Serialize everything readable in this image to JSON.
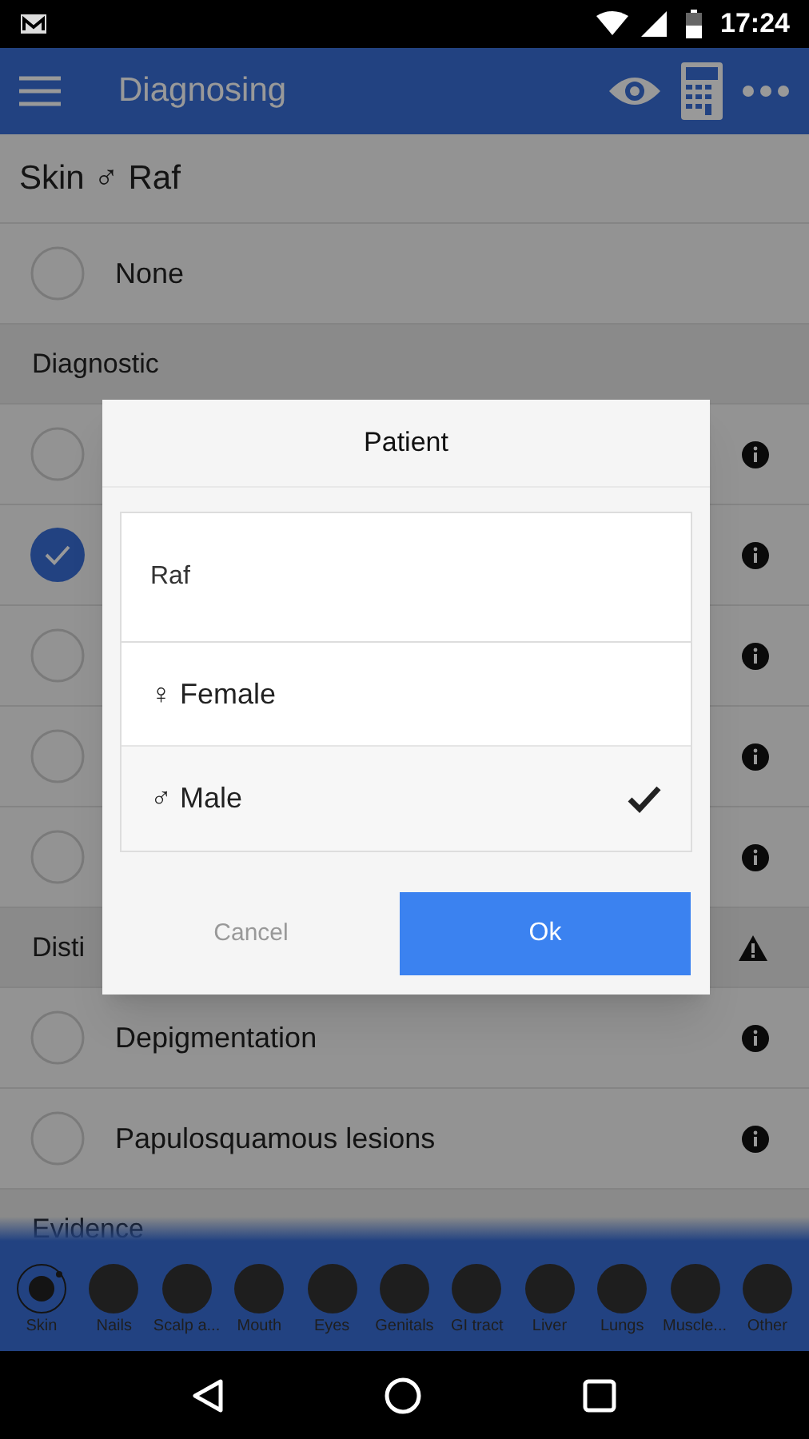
{
  "status_bar": {
    "time": "17:24"
  },
  "toolbar": {
    "title": "Diagnosing"
  },
  "subtitle": "Skin ♂ Raf",
  "list": [
    {
      "kind": "row",
      "label": "None",
      "checked": false,
      "info": false
    },
    {
      "kind": "section",
      "label": "Diagnostic"
    },
    {
      "kind": "row",
      "checked": false,
      "info": true
    },
    {
      "kind": "row",
      "checked": true,
      "info": true
    },
    {
      "kind": "row",
      "checked": false,
      "info": true
    },
    {
      "kind": "row",
      "checked": false,
      "info": true
    },
    {
      "kind": "row",
      "checked": false,
      "info": true
    },
    {
      "kind": "section",
      "label": "Disti",
      "warning": true
    },
    {
      "kind": "row",
      "label": "Depigmentation",
      "checked": false,
      "info": true
    },
    {
      "kind": "row",
      "label": "Papulosquamous lesions",
      "checked": false,
      "info": true
    },
    {
      "kind": "section",
      "label": "Evidence"
    }
  ],
  "dialog": {
    "title": "Patient",
    "name_value": "Raf",
    "options": [
      {
        "symbol": "♀",
        "label": "Female",
        "selected": false
      },
      {
        "symbol": "♂",
        "label": "Male",
        "selected": true
      }
    ],
    "cancel": "Cancel",
    "ok": "Ok"
  },
  "body_tabs": [
    {
      "label": "Skin",
      "selected": true
    },
    {
      "label": "Nails",
      "selected": false
    },
    {
      "label": "Scalp a...",
      "selected": false
    },
    {
      "label": "Mouth",
      "selected": false
    },
    {
      "label": "Eyes",
      "selected": false
    },
    {
      "label": "Genitals",
      "selected": false
    },
    {
      "label": "GI tract",
      "selected": false
    },
    {
      "label": "Liver",
      "selected": false
    },
    {
      "label": "Lungs",
      "selected": false
    },
    {
      "label": "Muscle...",
      "selected": false
    },
    {
      "label": "Other",
      "selected": false
    }
  ]
}
